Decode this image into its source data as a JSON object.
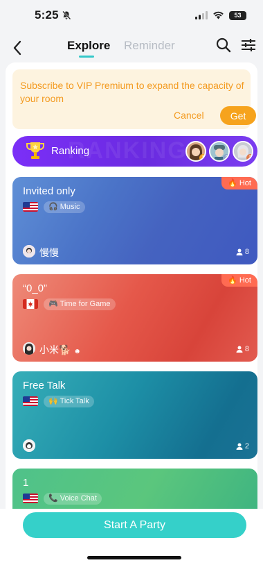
{
  "status_bar": {
    "time": "5:25",
    "battery": "53"
  },
  "nav": {
    "tabs": [
      "Explore",
      "Reminder"
    ],
    "active_tab": "Explore"
  },
  "vip_banner": {
    "text": "Subscribe to VIP Premium to expand the capacity of your room",
    "cancel_label": "Cancel",
    "get_label": "Get"
  },
  "ranking": {
    "label": "Ranking",
    "watermark": "RANKING",
    "badges": [
      "1",
      "2",
      "3"
    ]
  },
  "rooms": [
    {
      "title": "Invited only",
      "country": "US",
      "tag": "Music",
      "hot_label": "Hot",
      "host": "慢慢",
      "count": "8"
    },
    {
      "title": "“0_0”",
      "country": "CA",
      "tag": "Time for Game",
      "hot_label": "Hot",
      "host": "小米🐕",
      "count": "8"
    },
    {
      "title": "Free Talk",
      "country": "US",
      "tag": "Tick Talk",
      "hot_label": "",
      "host": "",
      "count": "2"
    },
    {
      "title": "1",
      "country": "US",
      "tag": "Voice Chat",
      "hot_label": "",
      "host": "",
      "count": ""
    }
  ],
  "cta": {
    "label": "Start A Party"
  },
  "colors": {
    "accent": "#35d0c9",
    "vip_text": "#f39a1f",
    "ranking_bg": "#7b2ff7",
    "hot": "#ff6b52"
  }
}
